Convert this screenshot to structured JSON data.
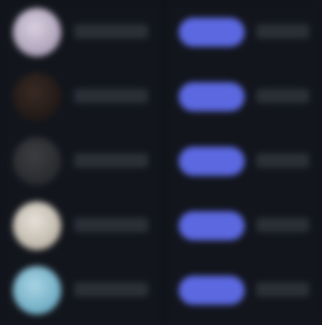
{
  "theme": {
    "background": "#12151c",
    "accent": "#5b68e0"
  },
  "rows": [
    {
      "avatar_colors": [
        "#d8d0e0",
        "#a89cb4"
      ]
    },
    {
      "avatar_colors": [
        "#3a2a24",
        "#1e1815"
      ]
    },
    {
      "avatar_colors": [
        "#3c3e42",
        "#26282c"
      ]
    },
    {
      "avatar_colors": [
        "#e6e2da",
        "#b9b1a4"
      ]
    },
    {
      "avatar_colors": [
        "#a8d4e4",
        "#6aa8c0"
      ]
    }
  ]
}
